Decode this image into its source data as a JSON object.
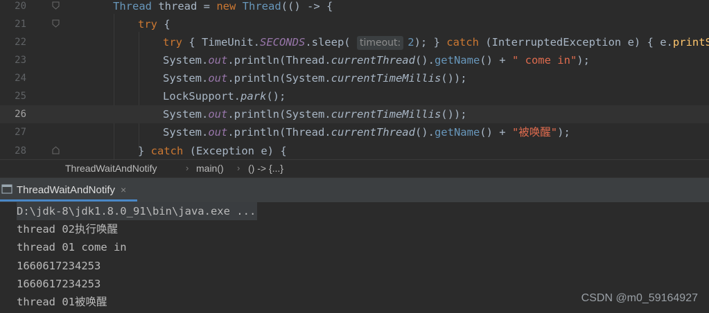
{
  "editor": {
    "lines": [
      {
        "num": "20"
      },
      {
        "num": "21"
      },
      {
        "num": "22"
      },
      {
        "num": "23"
      },
      {
        "num": "24"
      },
      {
        "num": "25"
      },
      {
        "num": "26"
      },
      {
        "num": "27"
      },
      {
        "num": "28"
      }
    ],
    "code": {
      "l20": {
        "Thread": "Thread",
        "var": " thread = ",
        "new": "new",
        "Thread2": " Thread",
        "rest": "(() -> {"
      },
      "l21": {
        "try": "try",
        "rest": " {"
      },
      "l22": {
        "try": "try",
        "open": " { TimeUnit.",
        "seconds": "SECONDS",
        "sleep": ".sleep( ",
        "hint": "timeout:",
        "num": "2",
        "close": "); } ",
        "catch": "catch",
        "rest": " (InterruptedException e) { e.",
        "print": "printStac"
      },
      "l23": {
        "a": "System.",
        "out": "out",
        "b": ".println(Thread.",
        "ct": "currentThread",
        "c": "().",
        "gn": "getName",
        "d": "() + ",
        "str": "\" come in\"",
        "e": ");"
      },
      "l24": {
        "a": "System.",
        "out": "out",
        "b": ".println(System.",
        "ctm": "currentTimeMillis",
        "c": "());"
      },
      "l25": {
        "a": "LockSupport.",
        "park": "park",
        "b": "();"
      },
      "l26": {
        "a": "System.",
        "out": "out",
        "b": ".println(System.",
        "ctm": "currentTimeMillis",
        "c": "());"
      },
      "l27": {
        "a": "System.",
        "out": "out",
        "b": ".println(Thread.",
        "ct": "currentThread",
        "c": "().",
        "gn": "getName",
        "d": "() + ",
        "str": "\"被唤醒\"",
        "e": ");"
      },
      "l28": {
        "a": "} ",
        "catch": "catch",
        "b": " (Exception e) {"
      }
    }
  },
  "breadcrumb": {
    "items": [
      "ThreadWaitAndNotify",
      "main()",
      "() -> {...}"
    ]
  },
  "run_panel": {
    "tab_label": "ThreadWaitAndNotify",
    "close_glyph": "×"
  },
  "console": {
    "lines": [
      "D:\\jdk-8\\jdk1.8.0_91\\bin\\java.exe ...",
      "thread 02执行唤醒",
      "thread 01 come in",
      "1660617234253",
      "1660617234253",
      "thread 01被唤醒"
    ]
  },
  "watermark": "CSDN @m0_59164927",
  "colors": {
    "background": "#2b2b2b",
    "keyword": "#cc7832",
    "field": "#9876aa",
    "string": "#6a8759",
    "number": "#6897bb",
    "accent": "#4a88c7"
  }
}
